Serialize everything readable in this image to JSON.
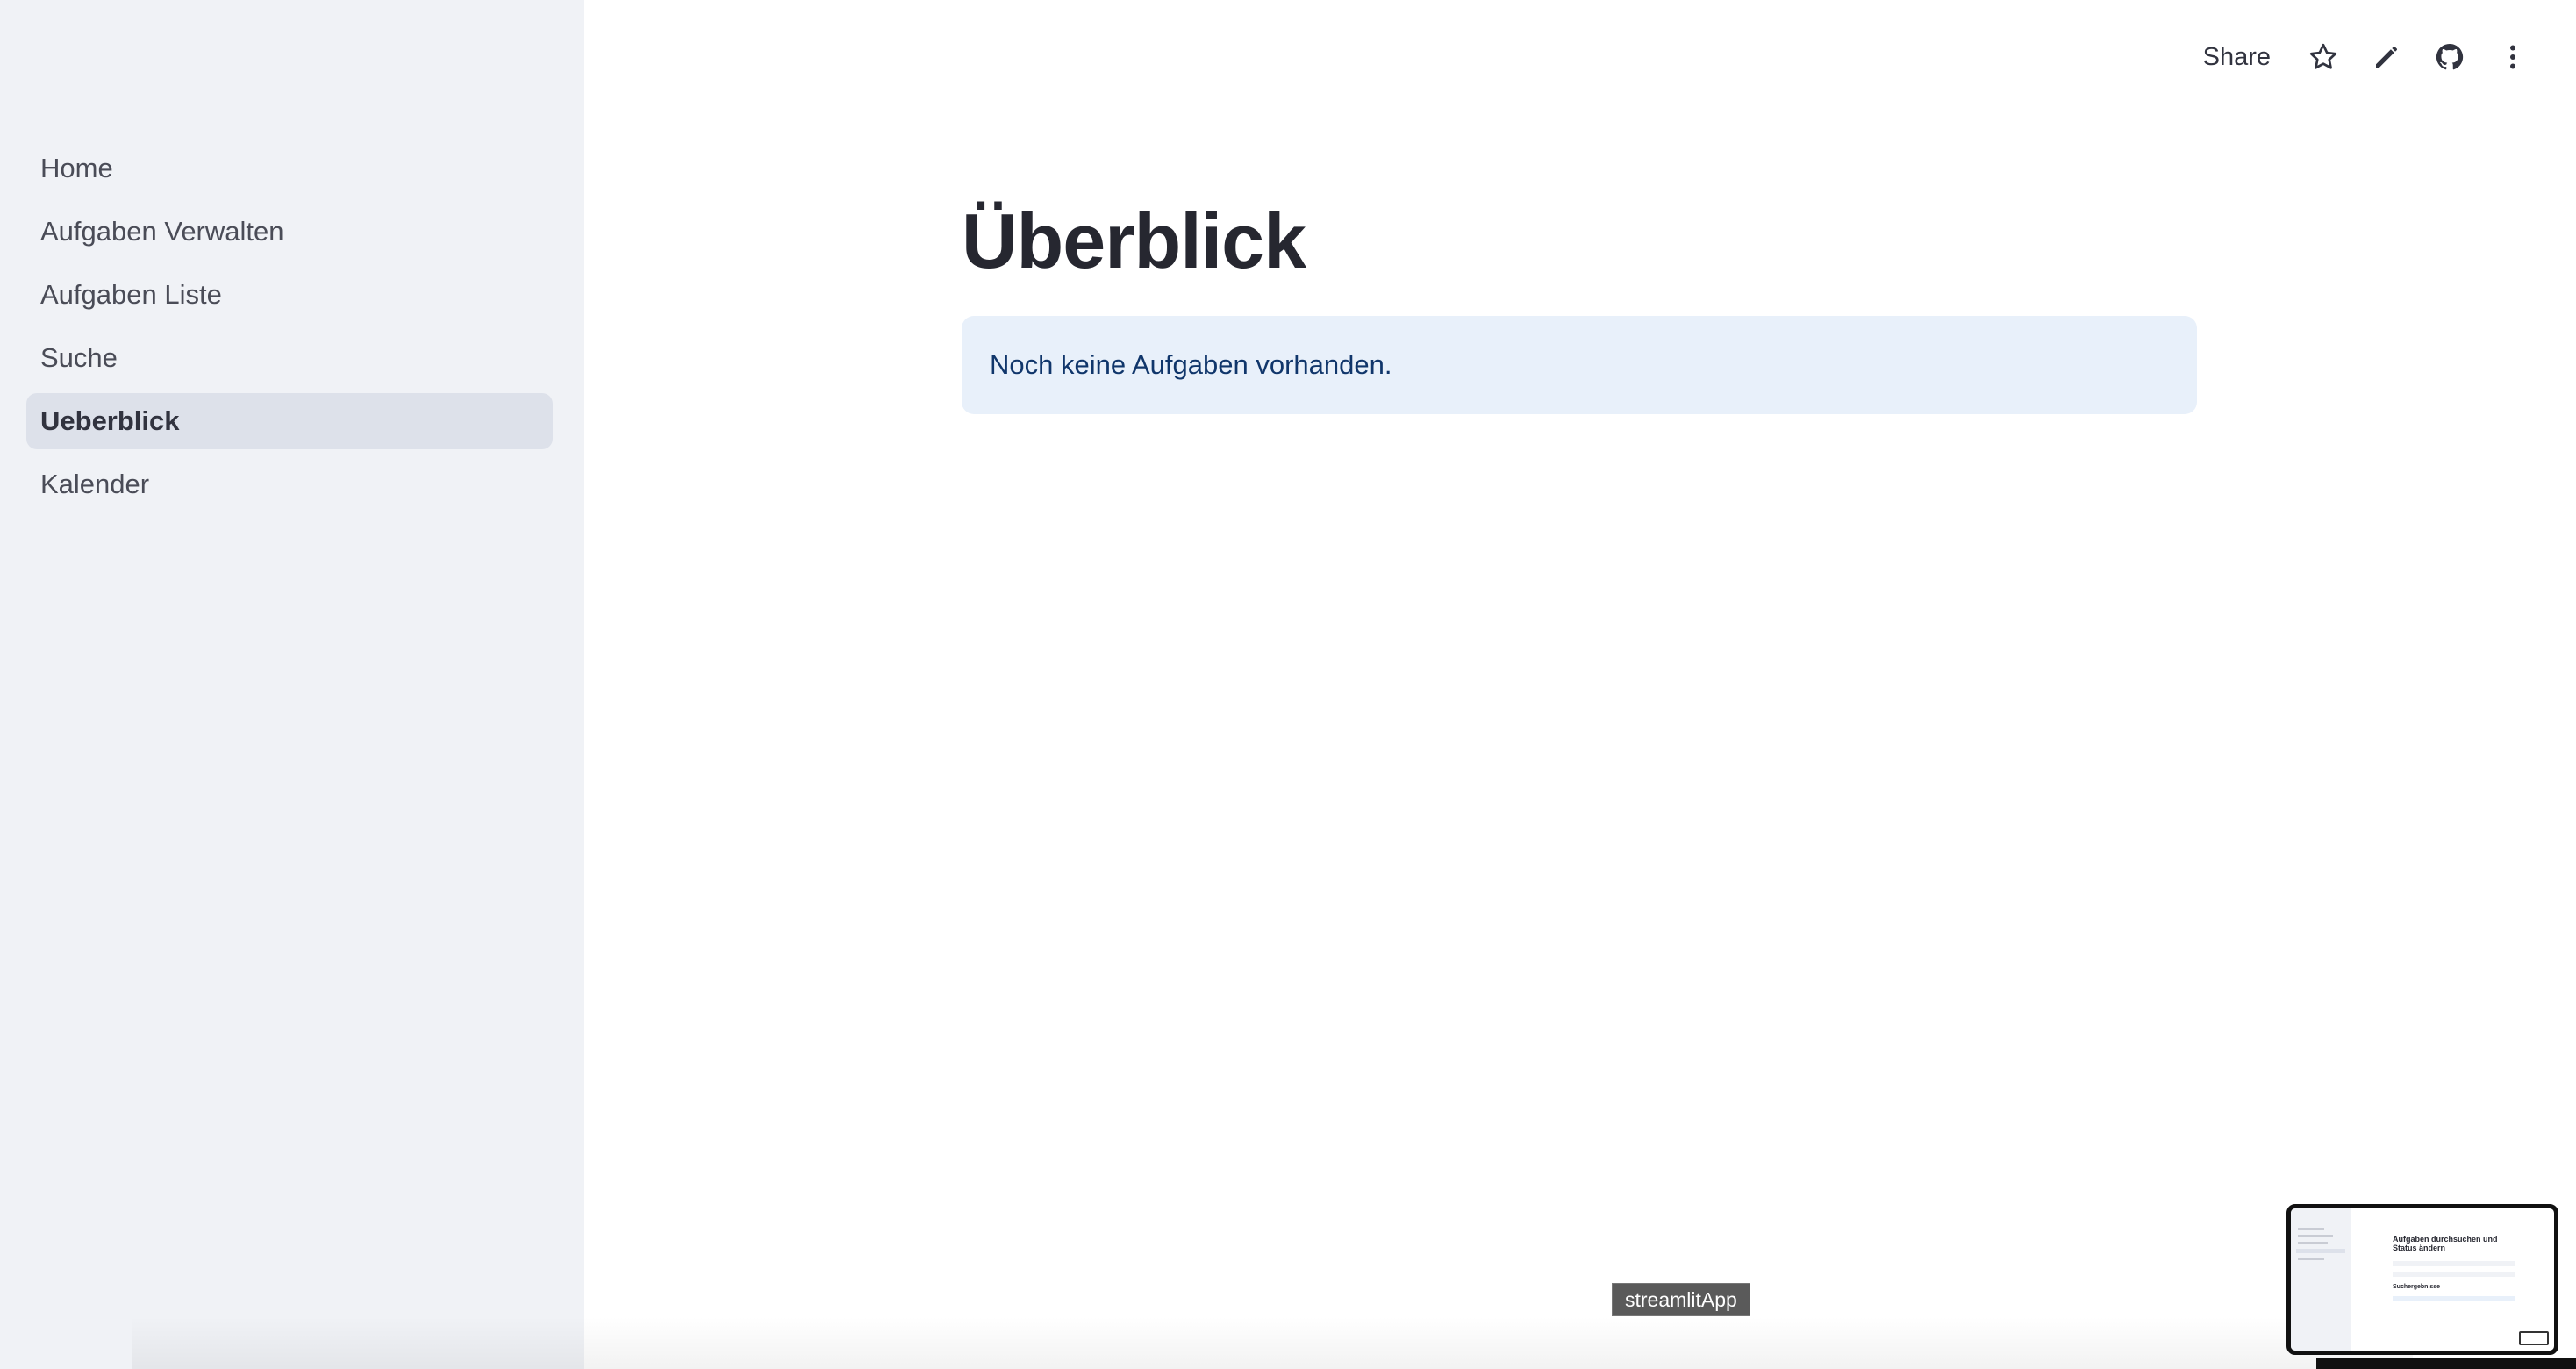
{
  "sidebar": {
    "items": [
      {
        "label": "Home",
        "active": false
      },
      {
        "label": "Aufgaben Verwalten",
        "active": false
      },
      {
        "label": "Aufgaben Liste",
        "active": false
      },
      {
        "label": "Suche",
        "active": false
      },
      {
        "label": "Ueberblick",
        "active": true
      },
      {
        "label": "Kalender",
        "active": false
      }
    ]
  },
  "toolbar": {
    "share_label": "Share",
    "icons": [
      "star-icon",
      "pencil-icon",
      "github-icon",
      "kebab-menu-icon"
    ]
  },
  "main": {
    "title": "Überblick",
    "info_message": "Noch keine Aufgaben vorhanden."
  },
  "tooltip": {
    "text": "streamlitApp"
  },
  "thumbnail": {
    "title": "Aufgaben durchsuchen und Status ändern",
    "subtitle": "Suchergebnisse"
  },
  "colors": {
    "sidebar_bg": "#f0f2f6",
    "active_item_bg": "#dde1ea",
    "info_bg": "#e8f0fa",
    "info_text": "#10366b",
    "title_text": "#262730"
  }
}
